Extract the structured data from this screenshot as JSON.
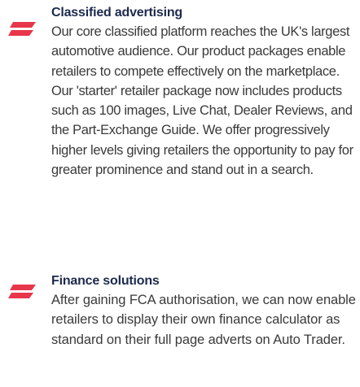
{
  "accent_color": "#e8364b",
  "heading_color": "#1d2a4d",
  "sections": [
    {
      "icon": "red-slash-bullet-icon",
      "heading": "Classified advertising",
      "body": "Our core classified platform reaches the UK's largest automotive audience. Our product packages enable retailers to compete effectively on the marketplace. Our 'starter' retailer package now includes products such as 100 images, Live Chat, Dealer Reviews, and the Part-Exchange Guide. We offer progressively higher levels giving retailers the opportunity to pay for greater prominence and stand out in a search."
    },
    {
      "icon": "red-slash-bullet-icon",
      "heading": "Finance solutions",
      "body": "After gaining FCA authorisation, we can now enable retailers to display their own finance calculator as standard on their full page adverts on Auto Trader."
    }
  ]
}
